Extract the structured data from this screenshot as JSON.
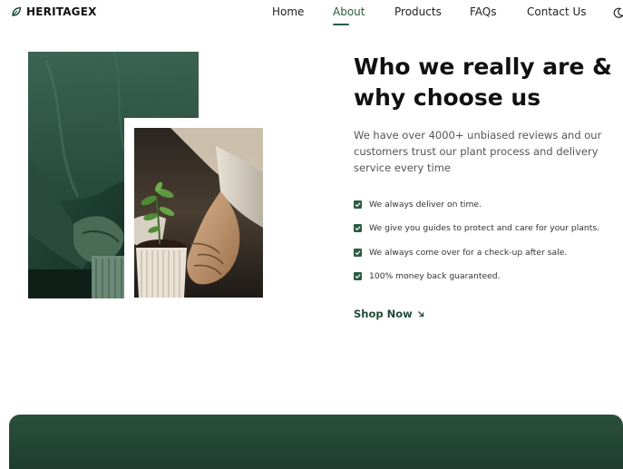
{
  "brand": {
    "name": "HERITAGEX",
    "icon": "leaf-icon",
    "accent_color": "#2b5c45"
  },
  "nav": {
    "items": [
      {
        "label": "Home",
        "active": false
      },
      {
        "label": "About",
        "active": true
      },
      {
        "label": "Products",
        "active": false
      },
      {
        "label": "FAQs",
        "active": false
      },
      {
        "label": "Contact Us",
        "active": false
      }
    ],
    "theme_toggle_icon": "moon-icon"
  },
  "hero": {
    "title": "Who we really are & why choose us",
    "description": "We have over 4000+ unbiased reviews and our customers trust our plant process and delivery service every time",
    "features": [
      "We always deliver on time.",
      "We give you guides to protect and care for your plants.",
      "We always come over for a check-up after sale.",
      "100% money back guaranteed."
    ],
    "cta_label": "Shop Now",
    "cta_icon": "arrow-down-right-icon"
  },
  "colors": {
    "banner": "#24483a",
    "check": "#2b5c45"
  }
}
